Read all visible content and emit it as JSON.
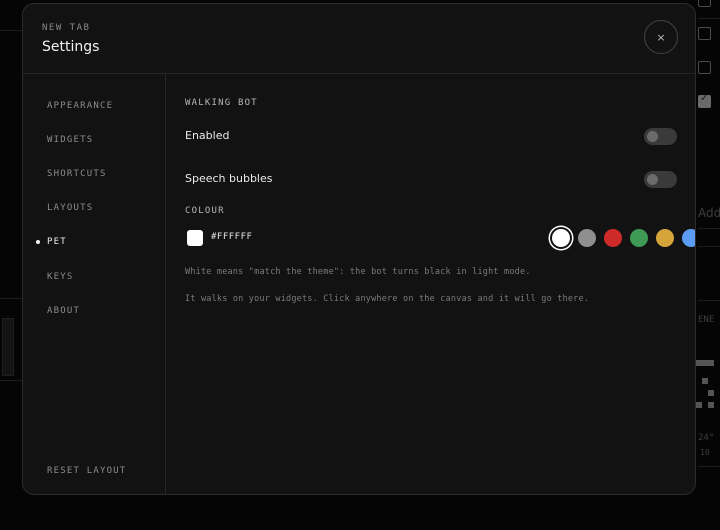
{
  "modal": {
    "eyebrow": "NEW TAB",
    "title": "Settings",
    "close_label": "×"
  },
  "sidebar": {
    "items": [
      {
        "label": "APPEARANCE",
        "active": false
      },
      {
        "label": "WIDGETS",
        "active": false
      },
      {
        "label": "SHORTCUTS",
        "active": false
      },
      {
        "label": "LAYOUTS",
        "active": false
      },
      {
        "label": "PET",
        "active": true
      },
      {
        "label": "KEYS",
        "active": false
      },
      {
        "label": "ABOUT",
        "active": false
      }
    ],
    "reset_label": "RESET LAYOUT"
  },
  "pet": {
    "section_title": "WALKING BOT",
    "enabled": {
      "label": "Enabled",
      "on": false
    },
    "speech": {
      "label": "Speech bubbles",
      "on": false
    },
    "colour_title": "COLOUR",
    "colour_value": "#FFFFFF",
    "swatches": [
      {
        "color": "#ffffff",
        "selected": true
      },
      {
        "color": "#8f8f8f",
        "selected": false
      },
      {
        "color": "#cf2a2a",
        "selected": false
      },
      {
        "color": "#3f9a55",
        "selected": false
      },
      {
        "color": "#d5a43a",
        "selected": false
      },
      {
        "color": "#5b9cf2",
        "selected": false
      }
    ],
    "hint1": "White means \"match the theme\": the bot turns black in light mode.",
    "hint2": "It walks on your widgets. Click anywhere on the canvas and it will go there."
  },
  "background": {
    "partial_texts": [
      "Add",
      "ENE",
      "24°",
      "10"
    ]
  }
}
